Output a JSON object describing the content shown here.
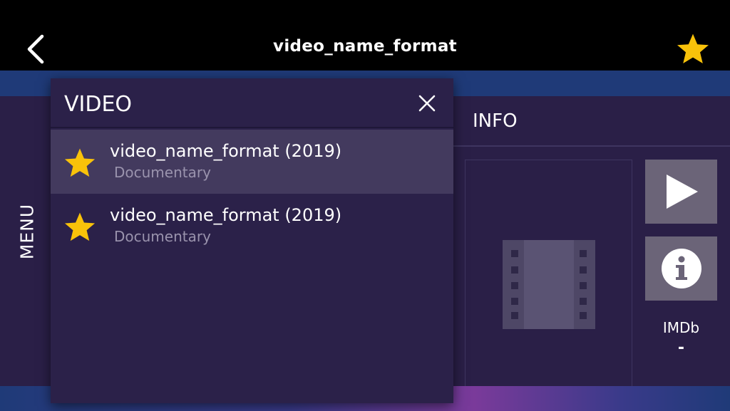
{
  "header": {
    "title": "video_name_format",
    "back_icon": "chevron-left-icon",
    "favorite_icon": "star-icon"
  },
  "menu": {
    "label": "MENU"
  },
  "info": {
    "header": "INFO",
    "poster_icon": "film-icon",
    "play_icon": "play-icon",
    "info_icon": "info-icon",
    "imdb_label": "IMDb",
    "imdb_value": "-"
  },
  "dialog": {
    "title": "VIDEO",
    "close_icon": "close-icon",
    "items": [
      {
        "title": "video_name_format (2019)",
        "subtitle": "Documentary",
        "icon": "star-icon",
        "selected": true
      },
      {
        "title": "video_name_format (2019)",
        "subtitle": "Documentary",
        "icon": "star-icon",
        "selected": false
      }
    ]
  },
  "colors": {
    "accent_star": "#f9c20a",
    "topbar": "#000000",
    "background": "#2a1f47",
    "selected_row": "#433a5e",
    "button_gray": "#6b6478",
    "blue_strip": "#1f3a78"
  }
}
